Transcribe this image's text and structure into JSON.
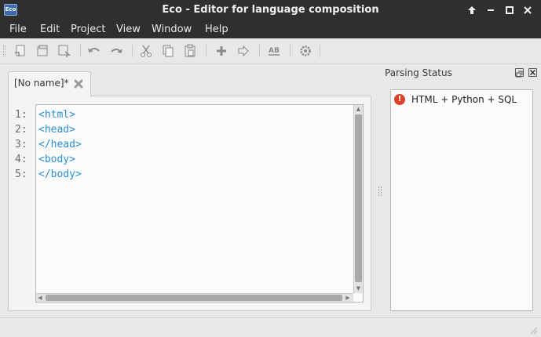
{
  "window": {
    "title": "Eco - Editor for language composition",
    "app_icon_text": "Eco",
    "controls": [
      "maximize-up",
      "minimize",
      "restore",
      "close"
    ]
  },
  "menu": {
    "items": [
      "File",
      "Edit",
      "Project",
      "View",
      "Window",
      "Help"
    ]
  },
  "toolbar": {
    "buttons": [
      {
        "name": "new-icon"
      },
      {
        "name": "open-icon"
      },
      {
        "name": "save-icon"
      },
      {
        "name": "undo-icon"
      },
      {
        "name": "redo-icon"
      },
      {
        "name": "cut-icon"
      },
      {
        "name": "copy-icon"
      },
      {
        "name": "paste-icon"
      },
      {
        "name": "add-language-box-icon"
      },
      {
        "name": "select-language-box-icon"
      },
      {
        "name": "parse-tree-icon"
      },
      {
        "name": "settings-icon"
      }
    ]
  },
  "editor": {
    "tab_label": "[No name]*",
    "line_numbers": [
      "1:",
      "2:",
      "3:",
      "4:",
      "5:"
    ],
    "lines": [
      "<html>",
      "<head>",
      "</head>",
      "<body>",
      "</body>"
    ],
    "code_color": "#2d8fd1"
  },
  "parsing_status": {
    "title": "Parsing Status",
    "items": [
      {
        "label": "HTML + Python + SQL",
        "status": "error",
        "status_color": "#d9412b"
      }
    ]
  }
}
